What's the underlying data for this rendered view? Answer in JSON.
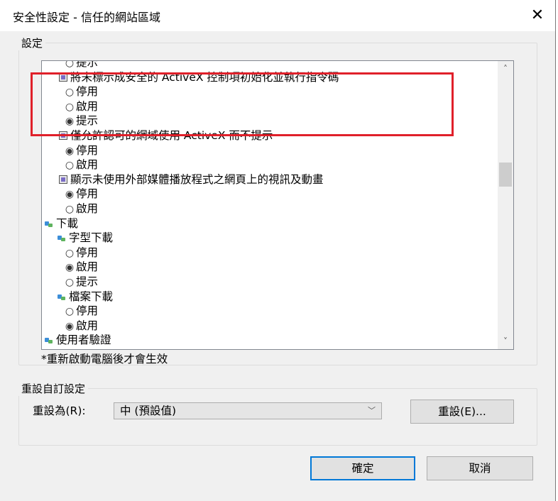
{
  "dialog": {
    "title": "安全性設定 - 信任的網站區域",
    "close_glyph": "✕"
  },
  "settings_group": {
    "legend": "設定",
    "items": [
      {
        "type": "radio",
        "selected": false,
        "label": "提示",
        "indent": 1
      },
      {
        "type": "setting",
        "label": "將未標示成安全的 ActiveX 控制項初始化並執行指令碼",
        "indent": 0
      },
      {
        "type": "radio",
        "selected": false,
        "label": "停用",
        "indent": 1
      },
      {
        "type": "radio",
        "selected": false,
        "label": "啟用",
        "indent": 1
      },
      {
        "type": "radio",
        "selected": true,
        "label": "提示",
        "indent": 1
      },
      {
        "type": "setting",
        "label": "僅允許認可的網域使用 ActiveX 而不提示",
        "indent": 0
      },
      {
        "type": "radio",
        "selected": true,
        "label": "停用",
        "indent": 1
      },
      {
        "type": "radio",
        "selected": false,
        "label": "啟用",
        "indent": 1
      },
      {
        "type": "setting",
        "label": "顯示未使用外部媒體播放程式之網頁上的視訊及動畫",
        "indent": 0
      },
      {
        "type": "radio",
        "selected": true,
        "label": "停用",
        "indent": 1
      },
      {
        "type": "radio",
        "selected": false,
        "label": "啟用",
        "indent": 1
      },
      {
        "type": "group",
        "label": "下載",
        "indent": -1
      },
      {
        "type": "group",
        "label": "字型下載",
        "indent": 0
      },
      {
        "type": "radio",
        "selected": false,
        "label": "停用",
        "indent": 1
      },
      {
        "type": "radio",
        "selected": true,
        "label": "啟用",
        "indent": 1
      },
      {
        "type": "radio",
        "selected": false,
        "label": "提示",
        "indent": 1
      },
      {
        "type": "group",
        "label": "檔案下載",
        "indent": 0
      },
      {
        "type": "radio",
        "selected": false,
        "label": "停用",
        "indent": 1
      },
      {
        "type": "radio",
        "selected": true,
        "label": "啟用",
        "indent": 1
      },
      {
        "type": "group",
        "label": "使用者驗證",
        "indent": -1
      }
    ],
    "scrollbar": {
      "up_glyph": "˄",
      "down_glyph": "˅",
      "position_fraction": 0.38
    },
    "note": "*重新啟動電腦後才會生效"
  },
  "reset_group": {
    "legend": "重設自訂設定",
    "label": "重設為(R):",
    "selected_value": "中 (預設值)",
    "dropdown_glyph": "﹀",
    "reset_button": "重設(E)..."
  },
  "footer": {
    "ok": "確定",
    "cancel": "取消"
  },
  "colors": {
    "highlight_box": "#e0202a",
    "ok_border": "#0078d7"
  }
}
